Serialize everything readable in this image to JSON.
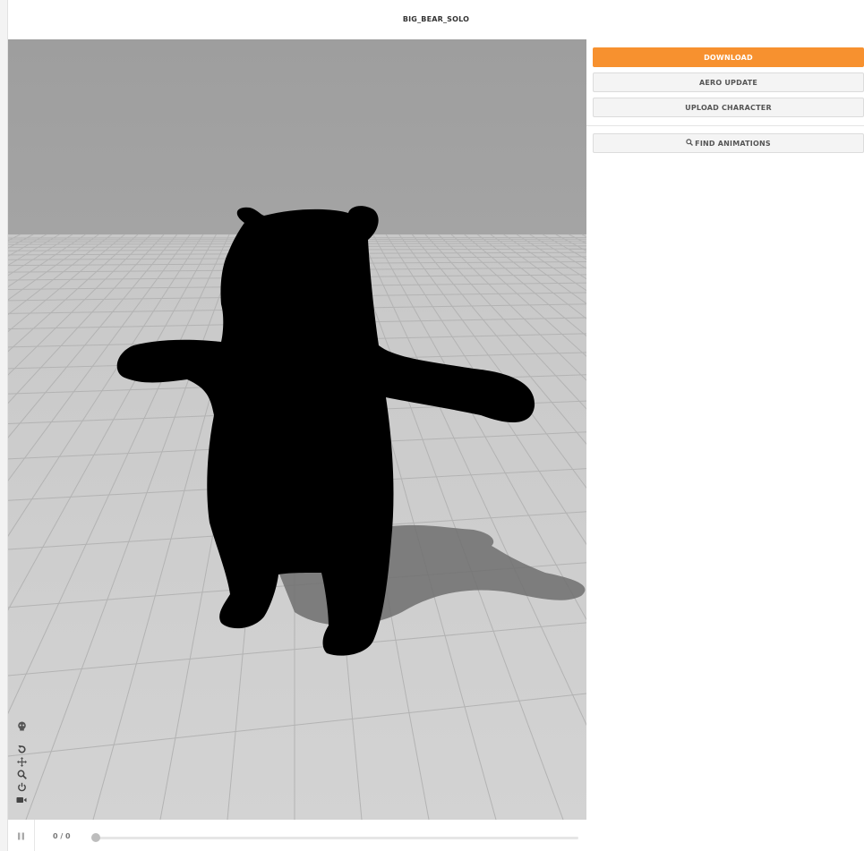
{
  "header": {
    "title": "BIG_BEAR_SOLO"
  },
  "panel": {
    "download_label": "DOWNLOAD",
    "aero_update_label": "AERO UPDATE",
    "upload_character_label": "UPLOAD CHARACTER",
    "find_animations_label": "FIND ANIMATIONS"
  },
  "viewport_tools": [
    "skeleton-icon",
    "reset-view-icon",
    "pan-icon",
    "zoom-icon",
    "power-icon",
    "camera-icon"
  ],
  "playback": {
    "frame_counter": "0 / 0",
    "progress": 0
  },
  "colors": {
    "accent": "#f7912f",
    "floor": "#cfcfcf",
    "sky": "#a4a4a4"
  }
}
